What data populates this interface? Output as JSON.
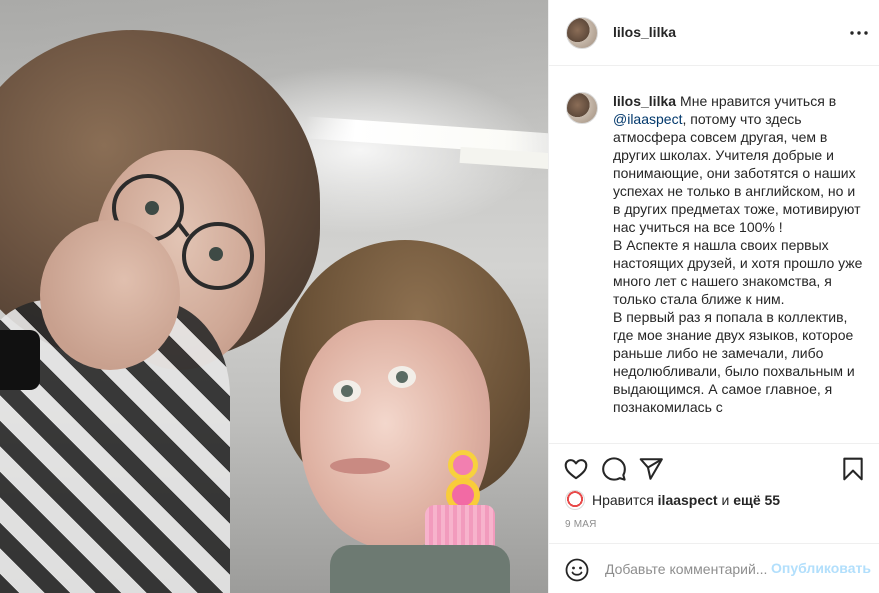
{
  "header": {
    "username": "lilos_lilka",
    "more_icon": "more-horizontal-icon"
  },
  "caption": {
    "username": "lilos_lilka",
    "text_before_mention": "Мне нравится учиться в",
    "mention": "@ilaaspect",
    "text_after_mention": ", потому что здесь атмосфера совсем другая, чем в других школах. Учителя добрые и понимающие, они заботятся о наших успехах не только в английском, но и в других предметах тоже, мотивируют нас учиться на все 100% !",
    "paragraph_2": "В Аспекте я нашла своих первых настоящих друзей, и хотя прошло уже много лет с нашего знакомства, я только стала ближе к ним.",
    "paragraph_3": "В первый раз я попала в коллектив, где мое знание двух языков, которое раньше либо не замечали, либо недолюбливали, было похвальным и выдающимся. А самое главное, я познакомилась с"
  },
  "actions": {
    "like_icon": "heart-icon",
    "comment_icon": "comment-icon",
    "share_icon": "paper-plane-icon",
    "save_icon": "bookmark-icon"
  },
  "likes": {
    "prefix": "Нравится",
    "user": "ilaaspect",
    "middle": "и",
    "others": "ещё 55"
  },
  "date": "9 мая",
  "comment": {
    "placeholder": "Добавьте комментарий...",
    "post_label": "Опубликовать",
    "emoji_icon": "smiley-icon"
  },
  "colors": {
    "text": "#262626",
    "secondary": "#8e8e8e",
    "mention": "#00376b",
    "post_button_disabled": "#b2dffc",
    "divider": "#efefef"
  }
}
